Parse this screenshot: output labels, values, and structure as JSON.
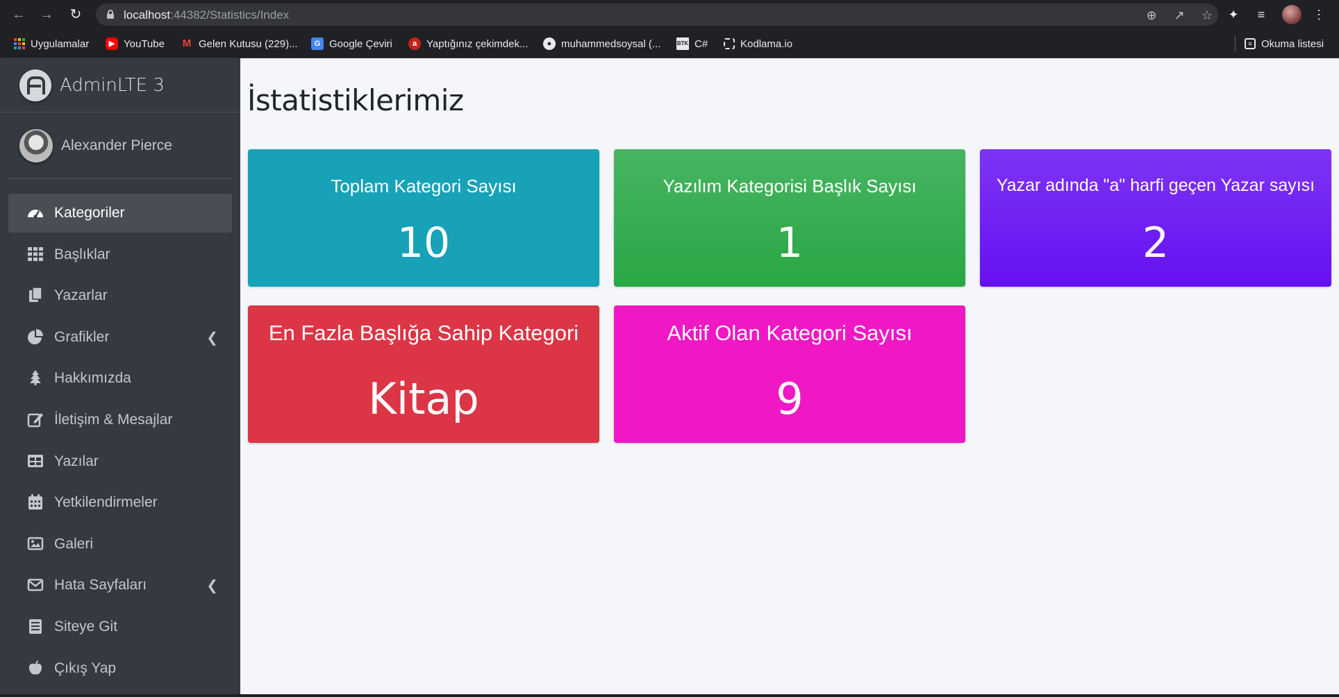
{
  "browser": {
    "url_host": "localhost",
    "url_path": ":44382/Statistics/Index",
    "bookmarks": [
      {
        "label": "Uygulamalar",
        "icon": "apps-grid-icon"
      },
      {
        "label": "YouTube",
        "icon": "youtube-icon"
      },
      {
        "label": "Gelen Kutusu (229)...",
        "icon": "gmail-icon"
      },
      {
        "label": "Google Çeviri",
        "icon": "google-translate-icon"
      },
      {
        "label": "Yaptığınız çekimdek...",
        "icon": "app-icon"
      },
      {
        "label": "muhammedsoysal (...",
        "icon": "github-icon"
      },
      {
        "label": "C#",
        "icon": "btk-icon"
      },
      {
        "label": "Kodlama.io",
        "icon": "kodlama-icon"
      }
    ],
    "reading_list": "Okuma listesi",
    "btk_badge": "BTK"
  },
  "sidebar": {
    "brand": "AdminLTE 3",
    "user_name": "Alexander Pierce",
    "items": [
      {
        "label": "Kategoriler",
        "icon": "tachometer-icon",
        "active": true,
        "has_arrow": false
      },
      {
        "label": "Başlıklar",
        "icon": "th-grid-icon",
        "active": false,
        "has_arrow": false
      },
      {
        "label": "Yazarlar",
        "icon": "copy-icon",
        "active": false,
        "has_arrow": false
      },
      {
        "label": "Grafikler",
        "icon": "chart-pie-icon",
        "active": false,
        "has_arrow": true
      },
      {
        "label": "Hakkımızda",
        "icon": "tree-icon",
        "active": false,
        "has_arrow": false
      },
      {
        "label": "İletişim & Mesajlar",
        "icon": "edit-icon",
        "active": false,
        "has_arrow": false
      },
      {
        "label": "Yazılar",
        "icon": "table-icon",
        "active": false,
        "has_arrow": false
      },
      {
        "label": "Yetkilendirmeler",
        "icon": "calendar-icon",
        "active": false,
        "has_arrow": false
      },
      {
        "label": "Galeri",
        "icon": "image-icon",
        "active": false,
        "has_arrow": false
      },
      {
        "label": "Hata Sayfaları",
        "icon": "envelope-icon",
        "active": false,
        "has_arrow": true
      },
      {
        "label": "Siteye Git",
        "icon": "book-icon",
        "active": false,
        "has_arrow": false
      },
      {
        "label": "Çıkış Yap",
        "icon": "apple-icon",
        "active": false,
        "has_arrow": false
      }
    ]
  },
  "main": {
    "page_title": "İstatistiklerimiz",
    "cards": [
      {
        "title": "Toplam Kategori Sayısı",
        "value": "10",
        "color": "#17a2b8"
      },
      {
        "title": "Yazılım Kategorisi Başlık Sayısı",
        "value": "1",
        "color": "#28a745"
      },
      {
        "title": "Yazar adında \"a\" harfi geçen Yazar sayısı",
        "value": "2",
        "color": "#6610f2"
      },
      {
        "title": "En Fazla Başlığa Sahip Kategori",
        "value": "Kitap",
        "color": "#dc3545"
      },
      {
        "title": "Aktif Olan Kategori Sayısı",
        "value": "9",
        "color": "#e83e8c"
      }
    ]
  }
}
